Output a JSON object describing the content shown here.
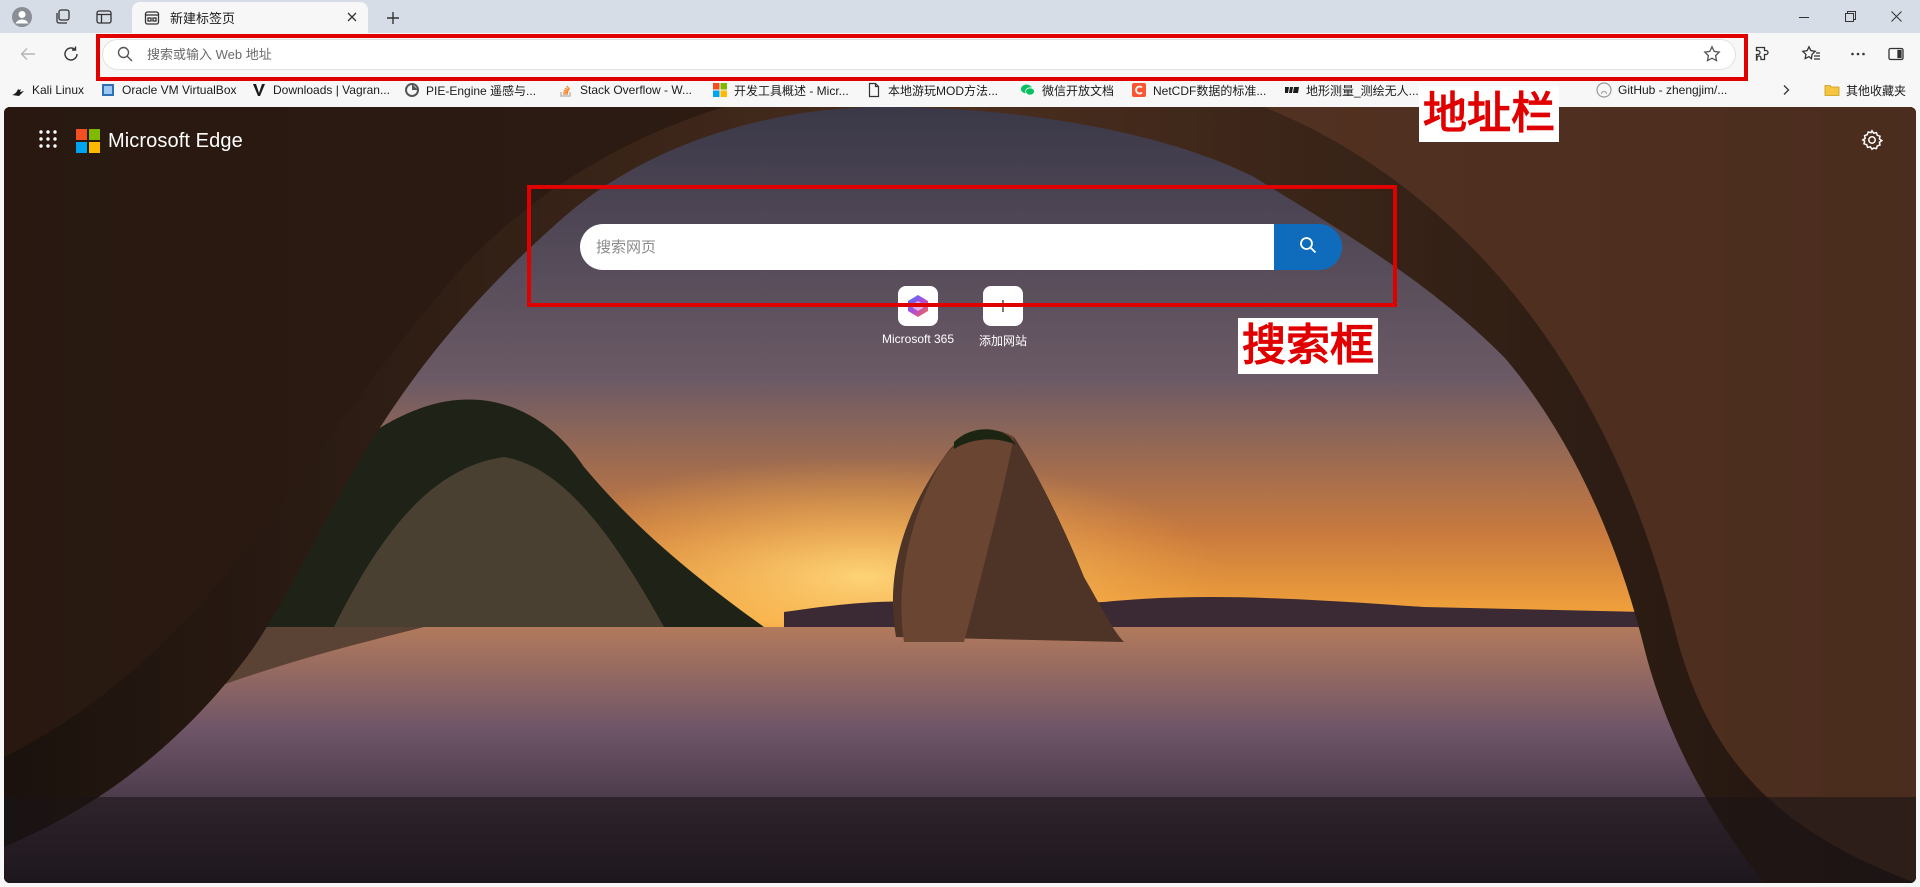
{
  "browser": {
    "tab_title": "新建标签页",
    "address_placeholder": "搜索或输入 Web 地址"
  },
  "bookmarks": [
    {
      "label": "Kali Linux",
      "icon": "kali-icon"
    },
    {
      "label": "Oracle VM VirtualBox",
      "icon": "virtualbox-icon"
    },
    {
      "label": "Downloads | Vagran...",
      "icon": "vagrant-icon"
    },
    {
      "label": "PIE-Engine 遥感与...",
      "icon": "pie-engine-icon"
    },
    {
      "label": "Stack Overflow - W...",
      "icon": "stackoverflow-icon"
    },
    {
      "label": "开发工具概述 - Micr...",
      "icon": "microsoft-icon"
    },
    {
      "label": "本地游玩MOD方法...",
      "icon": "page-icon"
    },
    {
      "label": "微信开放文档",
      "icon": "wechat-icon"
    },
    {
      "label": "NetCDF数据的标准...",
      "icon": "csdn-icon"
    },
    {
      "label": "地形测量_测绘无人...",
      "icon": "dji-icon"
    },
    {
      "label": "GitHub - zhengjim/...",
      "icon": "github-icon"
    },
    {
      "label": "其他收藏夹",
      "icon": "folder-icon"
    }
  ],
  "newtab": {
    "brand": "Microsoft Edge",
    "search_placeholder": "搜索网页",
    "quick_links": [
      {
        "label": "Microsoft 365",
        "icon": "microsoft-365-icon"
      },
      {
        "label": "添加网站",
        "icon": "add-icon"
      }
    ]
  },
  "annotations": {
    "address_bar_label": "地址栏",
    "search_box_label": "搜索框",
    "color": "#e00000"
  },
  "colors": {
    "accent": "#0f6cbd",
    "tabstrip": "#d7dde6"
  }
}
